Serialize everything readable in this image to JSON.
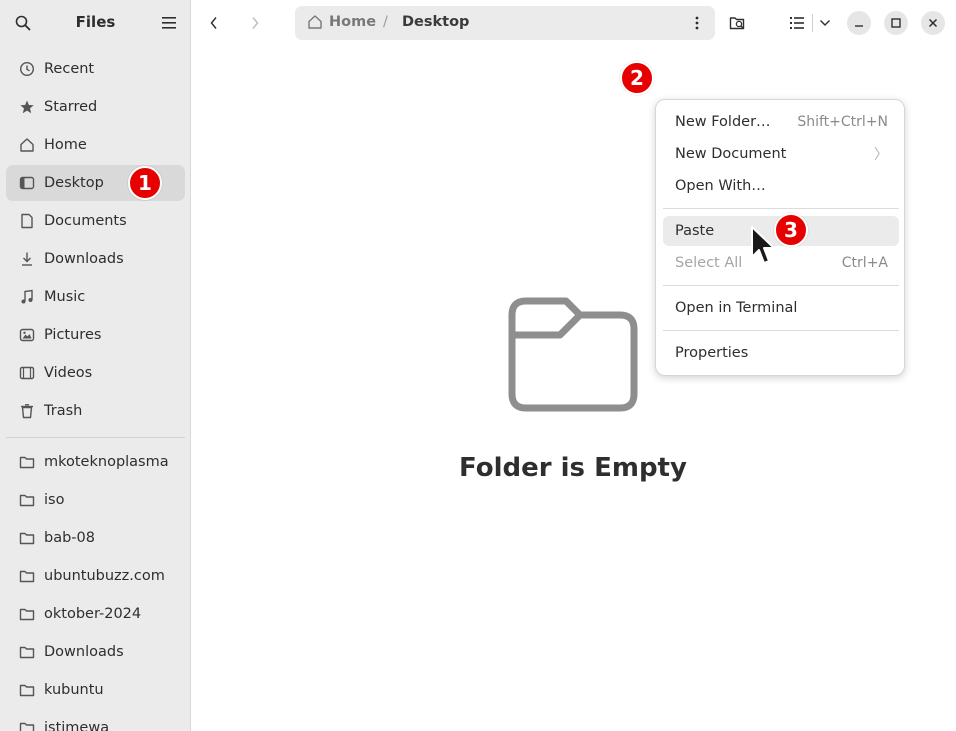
{
  "window": {
    "title": "Files"
  },
  "sidebar": {
    "title": "Files",
    "places": [
      {
        "label": "Recent",
        "icon": "clock-icon"
      },
      {
        "label": "Starred",
        "icon": "star-icon"
      },
      {
        "label": "Home",
        "icon": "home-icon"
      },
      {
        "label": "Desktop",
        "icon": "desktop-icon",
        "active": true
      },
      {
        "label": "Documents",
        "icon": "document-icon"
      },
      {
        "label": "Downloads",
        "icon": "download-icon"
      },
      {
        "label": "Music",
        "icon": "music-icon"
      },
      {
        "label": "Pictures",
        "icon": "picture-icon"
      },
      {
        "label": "Videos",
        "icon": "video-icon"
      },
      {
        "label": "Trash",
        "icon": "trash-icon"
      }
    ],
    "bookmarks": [
      {
        "label": "mkoteknoplasma"
      },
      {
        "label": "iso"
      },
      {
        "label": "bab-08"
      },
      {
        "label": "ubuntubuzz.com"
      },
      {
        "label": "oktober-2024"
      },
      {
        "label": "Downloads"
      },
      {
        "label": "kubuntu"
      },
      {
        "label": "istimewa"
      }
    ]
  },
  "pathbar": {
    "home": "Home",
    "separator": "/",
    "current": "Desktop"
  },
  "empty_state": {
    "title": "Folder is Empty"
  },
  "context_menu": {
    "items": [
      {
        "label": "New Folder…",
        "accel": "Shift+Ctrl+N"
      },
      {
        "label": "New Document",
        "submenu": "〉"
      },
      {
        "label": "Open With…"
      },
      {
        "label": "Paste",
        "hover": true
      },
      {
        "label": "Select All",
        "accel": "Ctrl+A",
        "disabled": true
      },
      {
        "label": "Open in Terminal"
      },
      {
        "label": "Properties"
      }
    ]
  },
  "badges": [
    "1",
    "2",
    "3"
  ],
  "colors": {
    "badge": "#e60000",
    "sidebar_bg": "#ebebeb",
    "active_item": "#d9d9d9"
  }
}
